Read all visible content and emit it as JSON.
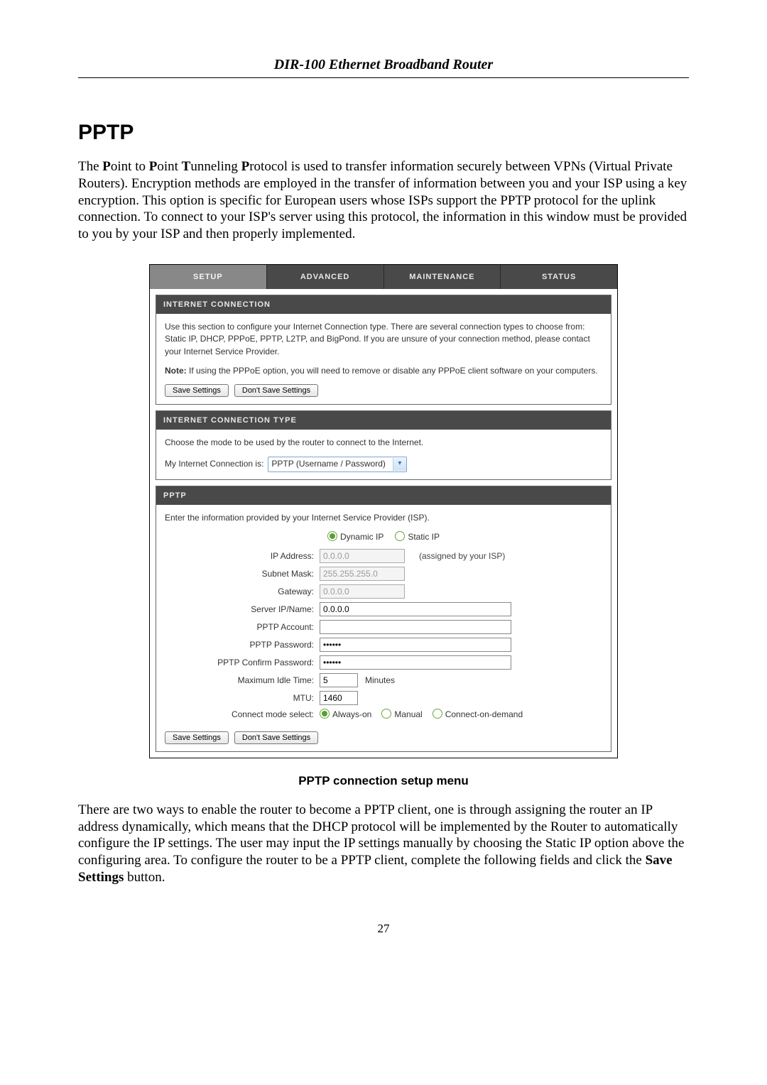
{
  "doc": {
    "running_header": "DIR-100 Ethernet Broadband Router",
    "section_title": "PPTP",
    "intro_html": "The Point to Point Tunneling Protocol is used to transfer information securely between VPNs (Virtual Private Routers). Encryption methods are employed in the transfer of information between you and your ISP using a key encryption. This option is specific for European users whose ISPs support the PPTP protocol for the uplink connection. To connect to your ISP's server using this protocol, the information in this window must be provided to you by your ISP and then properly implemented.",
    "figure_caption": "PPTP connection setup menu",
    "after_html": "There are two ways to enable the router to become a PPTP client, one is through assigning the router an IP address dynamically, which means that the DHCP protocol will be implemented by the Router to automatically configure the IP settings. The user may input the IP settings manually by choosing the Static IP option above the configuring area. To configure the router to be a PPTP client, complete the following fields and click the Save Settings button.",
    "page_number": "27"
  },
  "tabs": {
    "setup": "SETUP",
    "advanced": "ADVANCED",
    "maintenance": "MAINTENANCE",
    "status": "STATUS",
    "active_index": 0
  },
  "panel1": {
    "head": "INTERNET CONNECTION",
    "p1": "Use this section to configure your Internet Connection type. There are several connection types to choose from: Static IP, DHCP, PPPoE, PPTP, L2TP, and BigPond. If you are unsure of your connection method, please contact your Internet Service Provider.",
    "p2_prefix": "Note:",
    "p2_rest": " If using the PPPoE option, you will need to remove or disable any PPPoE client software on your computers.",
    "save": "Save Settings",
    "dont_save": "Don't Save Settings"
  },
  "panel2": {
    "head": "INTERNET CONNECTION TYPE",
    "prompt": "Choose the mode to be used by the router to connect to the Internet.",
    "label": "My Internet Connection is:",
    "selected": "PPTP (Username / Password)"
  },
  "panel3": {
    "head": "PPTP",
    "prompt": "Enter the information provided by your Internet Service Provider (ISP).",
    "ip_mode": {
      "dynamic_label": "Dynamic IP",
      "static_label": "Static IP",
      "selected": "dynamic"
    },
    "fields": {
      "ip_address": {
        "label": "IP Address:",
        "value": "0.0.0.0",
        "aside": "(assigned by your ISP)"
      },
      "subnet": {
        "label": "Subnet Mask:",
        "value": "255.255.255.0"
      },
      "gateway": {
        "label": "Gateway:",
        "value": "0.0.0.0"
      },
      "server": {
        "label": "Server IP/Name:",
        "value": "0.0.0.0"
      },
      "account": {
        "label": "PPTP Account:",
        "value": ""
      },
      "password": {
        "label": "PPTP Password:",
        "value": "••••••"
      },
      "confirm": {
        "label": "PPTP Confirm Password:",
        "value": "••••••"
      },
      "idle": {
        "label": "Maximum Idle Time:",
        "value": "5",
        "unit": "Minutes"
      },
      "mtu": {
        "label": "MTU:",
        "value": "1460"
      },
      "connect_mode": {
        "label": "Connect mode select:",
        "options": {
          "always": "Always-on",
          "manual": "Manual",
          "demand": "Connect-on-demand"
        },
        "selected": "always"
      }
    },
    "save": "Save Settings",
    "dont_save": "Don't Save Settings"
  }
}
